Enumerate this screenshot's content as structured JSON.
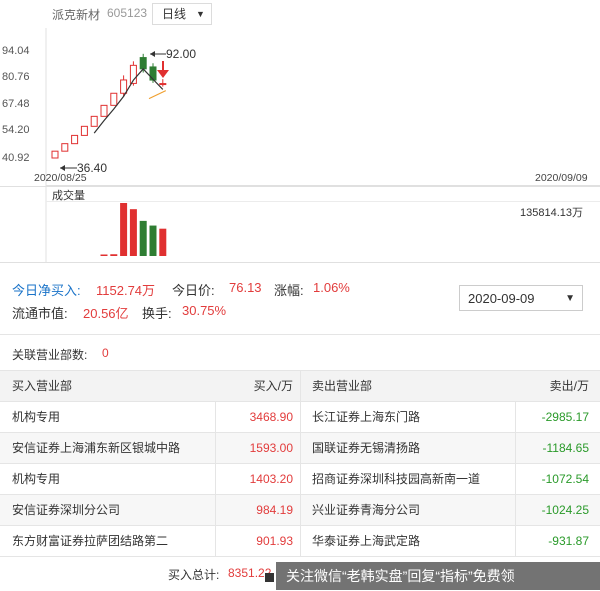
{
  "header": {
    "stock_name": "派克新材",
    "stock_code": "605123",
    "period": "日线"
  },
  "chart": {
    "y_ticks": [
      "94.04",
      "80.76",
      "67.48",
      "54.20",
      "40.92"
    ],
    "date_start": "2020/08/25",
    "date_end": "2020/09/09",
    "annot_high": "92.00",
    "annot_low": "36.40",
    "volume_label": "成交量",
    "volume_max": "135814.13万",
    "colors": {
      "up": "#e03030",
      "down": "#2e7d32",
      "ma": "#333333",
      "ma_short": "#f0a030",
      "arrow": "#e03030"
    }
  },
  "chart_data": {
    "type": "candlestick",
    "x": [
      "2020/08/25",
      "2020/08/26",
      "2020/08/27",
      "2020/08/28",
      "2020/08/31",
      "2020/09/01",
      "2020/09/02",
      "2020/09/03",
      "2020/09/04",
      "2020/09/07",
      "2020/09/08",
      "2020/09/09"
    ],
    "open": [
      36.4,
      40.04,
      44.05,
      48.46,
      53.3,
      58.63,
      64.5,
      70.95,
      76.2,
      90.0,
      85.0,
      76.0
    ],
    "close": [
      40.04,
      44.05,
      48.46,
      53.3,
      58.63,
      64.5,
      70.95,
      78.05,
      85.85,
      84.0,
      78.0,
      76.13
    ],
    "high": [
      40.04,
      44.05,
      48.46,
      53.3,
      58.63,
      64.5,
      70.95,
      80.5,
      88.0,
      92.0,
      87.0,
      78.5
    ],
    "low": [
      36.4,
      40.04,
      44.05,
      48.46,
      53.3,
      58.63,
      64.5,
      69.0,
      75.0,
      82.0,
      76.5,
      74.5
    ],
    "volume": [
      0,
      0,
      0,
      0,
      0,
      1500,
      4500,
      135814.13,
      120000,
      90000,
      78000,
      70000
    ],
    "ylim": [
      36.4,
      94.04
    ]
  },
  "stats": {
    "net_buy_label": "今日净买入:",
    "net_buy_value": "1152.74万",
    "price_label": "今日价:",
    "price_value": "76.13",
    "change_label": "涨幅:",
    "change_value": "1.06%",
    "mktcap_label": "流通市值:",
    "mktcap_value": "20.56亿",
    "turnover_label": "换手:",
    "turnover_value": "30.75%"
  },
  "date_select": {
    "value": "2020-09-09"
  },
  "related": {
    "label": "关联营业部数:",
    "value": "0"
  },
  "table": {
    "headers": {
      "buy_dept": "买入营业部",
      "buy_amt": "买入/万",
      "sell_dept": "卖出营业部",
      "sell_amt": "卖出/万"
    },
    "rows": [
      {
        "buy_dept": "机构专用",
        "buy_amt": "3468.90",
        "sell_dept": "长江证券上海东门路",
        "sell_amt": "-2985.17"
      },
      {
        "buy_dept": "安信证券上海浦东新区银城中路",
        "buy_amt": "1593.00",
        "sell_dept": "国联证券无锡清扬路",
        "sell_amt": "-1184.65"
      },
      {
        "buy_dept": "机构专用",
        "buy_amt": "1403.20",
        "sell_dept": "招商证券深圳科技园高新南一道",
        "sell_amt": "-1072.54"
      },
      {
        "buy_dept": "安信证券深圳分公司",
        "buy_amt": "984.19",
        "sell_dept": "兴业证券青海分公司",
        "sell_amt": "-1024.25"
      },
      {
        "buy_dept": "东方财富证券拉萨团结路第二",
        "buy_amt": "901.93",
        "sell_dept": "华泰证券上海武定路",
        "sell_amt": "-931.87"
      }
    ],
    "total_label": "买入总计:",
    "total_value": "8351.22"
  },
  "watermark": {
    "text": "关注微信“老韩实盘”回复“指标”免费领"
  }
}
